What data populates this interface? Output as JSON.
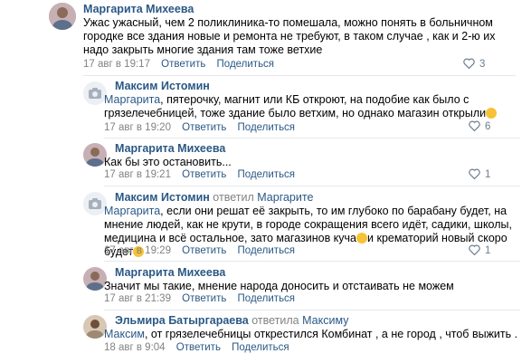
{
  "actions": {
    "reply": "Ответить",
    "share": "Поделиться"
  },
  "comments": [
    {
      "author": "Маргарита Михеева",
      "text": "Ужас ужасный, чем 2 поликлиника-то помешала, можно понять в больничном городке все здания новые и ремонта не требуют, в таком случае , как и 2-ю их надо закрыть многие здания там тоже ветхие",
      "date": "17 авг в 19:17",
      "likes": "3"
    },
    {
      "author": "Максим Истомин",
      "mention": "Маргарита",
      "text": ", пятерочку, магнит или КБ откроют, на подобие как было с грязелечебницей, тоже здание было ветхим, но однако магазин открыли",
      "date": "17 авг в 19:20",
      "likes": "6"
    },
    {
      "author": "Маргарита Михеева",
      "text": "Как бы это остановить...",
      "date": "17 авг в 19:21",
      "likes": "1"
    },
    {
      "author": "Максим Истомин",
      "replied_label": "ответил",
      "replied_to": "Маргарите",
      "mention": "Маргарита",
      "text_a": ", если они решат её закрыть, то им глубоко по барабану будет, на мнение людей, как не крути, в городе сокращения всего идёт, садики, школы, медицина и всё остальное, зато магазинов куча",
      "text_b": "и крематорий новый скоро будет",
      "date": "17 авг в 19:29",
      "likes": "1"
    },
    {
      "author": "Маргарита Михеева",
      "text": "Значит мы такие, мнение народа доносить и отстаивать не можем",
      "date": "17 авг в 21:39",
      "likes": ""
    },
    {
      "author": "Эльмира Батыргараева",
      "replied_label": "ответила",
      "replied_to": "Максиму",
      "mention": "Максим",
      "text": ", от грязелечебницы открестился Комбинат , а не город , чтоб выжить .",
      "date": "18 авг в 9:04",
      "likes": ""
    }
  ]
}
